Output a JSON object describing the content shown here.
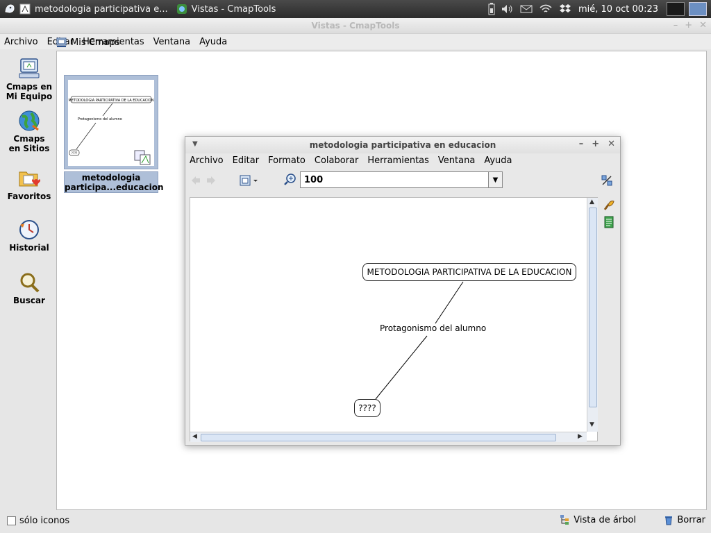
{
  "system_panel": {
    "tasks": [
      {
        "label": "metodologia participativa e..."
      },
      {
        "label": "Vistas - CmapTools"
      }
    ],
    "clock": "mié, 10 oct  00:23"
  },
  "main_window": {
    "title": "Vistas - CmapTools",
    "menu": [
      "Archivo",
      "Editar",
      "Herramientas",
      "Ventana",
      "Ayuda"
    ],
    "path_label": "Mis Cmaps",
    "sidebar": [
      {
        "label1": "Cmaps en",
        "label2": "Mi Equipo"
      },
      {
        "label1": "Cmaps",
        "label2": "en Sitios"
      },
      {
        "label1": "Favoritos",
        "label2": ""
      },
      {
        "label1": "Historial",
        "label2": ""
      },
      {
        "label1": "Buscar",
        "label2": ""
      }
    ],
    "thumbnail": {
      "label_line1": "metodologia",
      "label_line2": "participa...educacion",
      "preview_title": "METODOLOGIA PARTICIPATIVA DE LA EDUCACION",
      "preview_link": "Protagonismo del alumno",
      "preview_node": "????"
    },
    "status": {
      "only_icons": "sólo iconos",
      "tree_view": "Vista de árbol",
      "delete": "Borrar"
    }
  },
  "cmap_window": {
    "title": "metodologia participativa en educacion",
    "menu": [
      "Archivo",
      "Editar",
      "Formato",
      "Colaborar",
      "Herramientas",
      "Ventana",
      "Ayuda"
    ],
    "zoom_value": "100",
    "concepts": {
      "main": "METODOLOGIA PARTICIPATIVA DE LA EDUCACION",
      "link": "Protagonismo del alumno",
      "target": "????"
    }
  },
  "colors": {
    "selection": "#aebfd8",
    "panel_dark": "#2b2b2b"
  }
}
